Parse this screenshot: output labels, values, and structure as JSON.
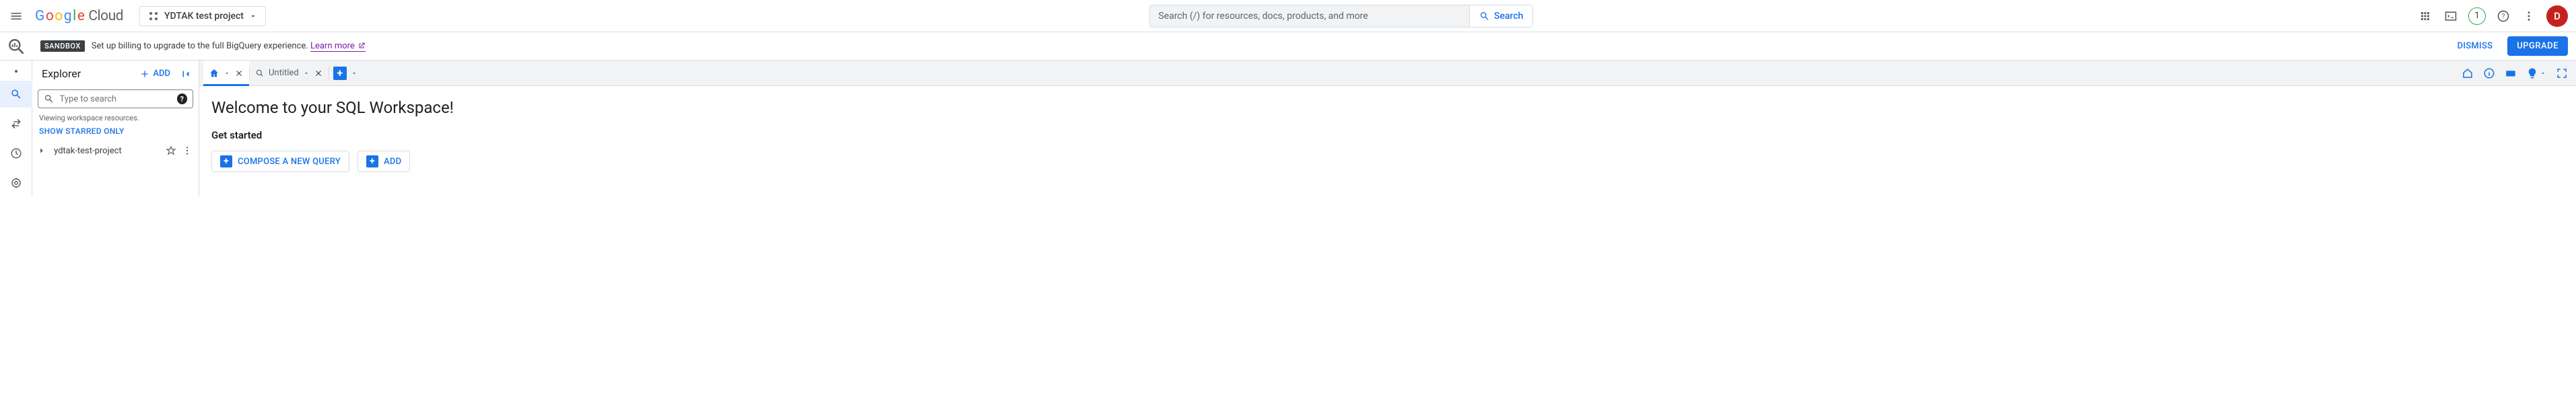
{
  "header": {
    "logo_cloud": "Cloud",
    "project_name": "YDTAK test project",
    "search_placeholder": "Search (/) for resources, docs, products, and more",
    "search_btn": "Search",
    "notif_count": "1",
    "avatar_initial": "D"
  },
  "banner": {
    "badge": "SANDBOX",
    "text": "Set up billing to upgrade to the full BigQuery experience.",
    "learn_more": "Learn more",
    "dismiss": "DISMISS",
    "upgrade": "UPGRADE"
  },
  "explorer": {
    "title": "Explorer",
    "add": "ADD",
    "search_placeholder": "Type to search",
    "viewing": "Viewing workspace resources.",
    "show_starred": "SHOW STARRED ONLY",
    "project_node": "ydtak-test-project"
  },
  "tabs": {
    "untitled": "Untitled"
  },
  "welcome": {
    "title": "Welcome to your SQL Workspace!",
    "subtitle": "Get started",
    "compose": "COMPOSE A NEW QUERY",
    "add": "ADD"
  }
}
